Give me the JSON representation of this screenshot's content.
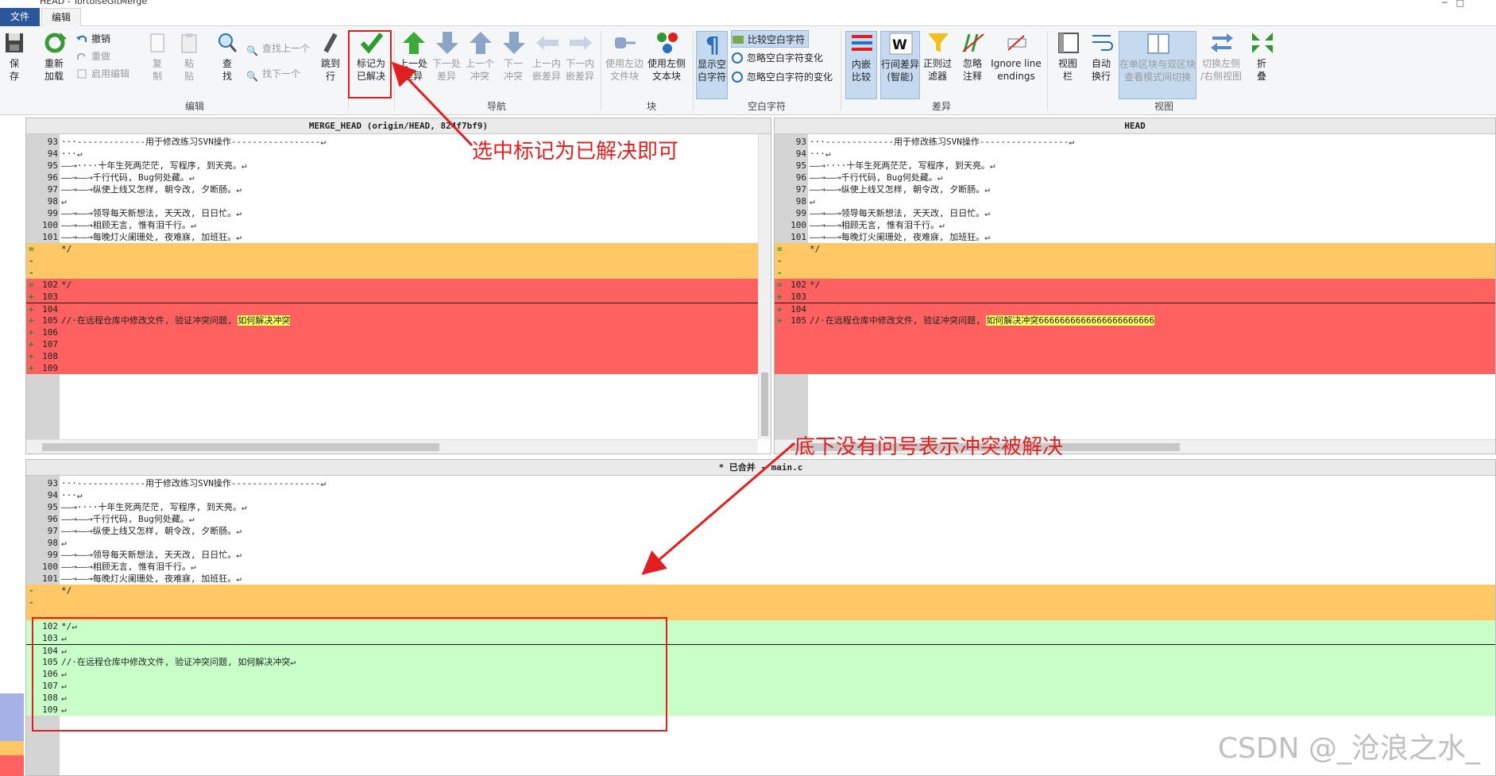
{
  "window": {
    "title": "HEAD - TortoiseGitMerge"
  },
  "tabs": {
    "file": "文件",
    "edit": "编辑"
  },
  "ribbon": {
    "save": "保\n存",
    "reload": "重新\n加载",
    "undo": "撤销",
    "redo": "重做",
    "enable_edit": "启用编辑",
    "copy": "复\n制",
    "paste": "粘\n贴",
    "find": "查\n找",
    "find_prev": "查找上一个",
    "find_next": "找下一个",
    "goto": "跳到\n行",
    "mark_resolved": "标记为\n已解决",
    "prev_diff": "上一处\n差异",
    "next_diff": "下一处\n差异",
    "prev_conflict": "上一个\n冲突",
    "next_conflict": "下一\n冲突",
    "prev_inline": "上一内\n嵌差异",
    "next_inline": "下一内\n嵌差异",
    "use_left_block": "使用左边\n文件块",
    "use_left_text": "使用左侧\n文本块",
    "show_ws": "显示空\n白字符",
    "compare_ws": "比较空白字符",
    "ignore_ws_change": "忽略空白字符变化",
    "ignore_ws_changes": "忽略空白字符的变化",
    "inline_compare": "内嵌\n比较",
    "line_diff_smart": "行间差异\n(智能)",
    "regex_filter": "正则过\n滤器",
    "ignore_comments": "忽略\n注释",
    "ignore_line_endings": "Ignore line\nendings",
    "view_bar": "视图\n栏",
    "auto_wrap": "自动\n换行",
    "toggle_view": "在单区块与双区块\n查看模式间切换",
    "swap_view": "切换左侧\n/右侧视图",
    "fold": "折\n叠",
    "groups": {
      "edit": "编辑",
      "nav": "导航",
      "block": "块",
      "whitespace": "空白字符",
      "diff": "差异",
      "view": "视图"
    }
  },
  "left_pane": {
    "header": "MERGE_HEAD (origin/HEAD, 824f7bf9)",
    "lines": [
      {
        "mk": "",
        "num": "93",
        "text": "···-------------用于修改练习SVN操作-----------------↵",
        "bg": ""
      },
      {
        "mk": "",
        "num": "94",
        "text": "···↵",
        "bg": ""
      },
      {
        "mk": "",
        "num": "95",
        "text": "——→····十年生死两茫茫, 写程序, 到天亮。↵",
        "bg": ""
      },
      {
        "mk": "",
        "num": "96",
        "text": "——→——→千行代码, Bug何处藏。↵",
        "bg": ""
      },
      {
        "mk": "",
        "num": "97",
        "text": "——→——→纵使上线又怎样, 朝令改, 夕断肠。↵",
        "bg": ""
      },
      {
        "mk": "",
        "num": "98",
        "text": "↵",
        "bg": ""
      },
      {
        "mk": "",
        "num": "99",
        "text": "——→——→领导每天新想法, 天天改, 日日忙。↵",
        "bg": ""
      },
      {
        "mk": "",
        "num": "100",
        "text": "——→——→相顾无言, 惟有泪千行。↵",
        "bg": ""
      },
      {
        "mk": "",
        "num": "101",
        "text": "——→——→每晚灯火阑珊处, 夜难寐, 加班狂。↵",
        "bg": ""
      },
      {
        "mk": "=",
        "num": "",
        "text": "*/",
        "bg": "orange"
      },
      {
        "mk": "-",
        "num": "",
        "text": "",
        "bg": "orange"
      },
      {
        "mk": "-",
        "num": "",
        "text": "",
        "bg": "orange"
      },
      {
        "mk": "=",
        "num": "102",
        "text": "*/",
        "bg": "red"
      },
      {
        "mk": "+",
        "num": "103",
        "text": "",
        "bg": "red"
      },
      {
        "mk": "+",
        "num": "104",
        "text": "",
        "bg": "red"
      },
      {
        "mk": "+",
        "num": "105",
        "text": "//·在远程仓库中修改文件, 验证冲突问题, ",
        "hl": "如何解决冲突",
        "bg": "red"
      },
      {
        "mk": "+",
        "num": "106",
        "text": "",
        "bg": "red"
      },
      {
        "mk": "+",
        "num": "107",
        "text": "",
        "bg": "red"
      },
      {
        "mk": "+",
        "num": "108",
        "text": "",
        "bg": "red"
      },
      {
        "mk": "+",
        "num": "109",
        "text": "",
        "bg": "red"
      }
    ]
  },
  "right_pane": {
    "header": "HEAD",
    "lines": [
      {
        "mk": "",
        "num": "93",
        "text": "···-------------用于修改练习SVN操作-----------------↵",
        "bg": ""
      },
      {
        "mk": "",
        "num": "94",
        "text": "···↵",
        "bg": ""
      },
      {
        "mk": "",
        "num": "95",
        "text": "——→····十年生死两茫茫, 写程序, 到天亮。↵",
        "bg": ""
      },
      {
        "mk": "",
        "num": "96",
        "text": "——→——→千行代码, Bug何处藏。↵",
        "bg": ""
      },
      {
        "mk": "",
        "num": "97",
        "text": "——→——→纵使上线又怎样, 朝令改, 夕断肠。↵",
        "bg": ""
      },
      {
        "mk": "",
        "num": "98",
        "text": "↵",
        "bg": ""
      },
      {
        "mk": "",
        "num": "99",
        "text": "——→——→领导每天新想法, 天天改, 日日忙。↵",
        "bg": ""
      },
      {
        "mk": "",
        "num": "100",
        "text": "——→——→相顾无言, 惟有泪千行。↵",
        "bg": ""
      },
      {
        "mk": "",
        "num": "101",
        "text": "——→——→每晚灯火阑珊处, 夜难寐, 加班狂。↵",
        "bg": ""
      },
      {
        "mk": "=",
        "num": "",
        "text": "*/",
        "bg": "orange"
      },
      {
        "mk": "-",
        "num": "",
        "text": "",
        "bg": "orange"
      },
      {
        "mk": "-",
        "num": "",
        "text": "",
        "bg": "orange"
      },
      {
        "mk": "=",
        "num": "102",
        "text": "*/",
        "bg": "red"
      },
      {
        "mk": "+",
        "num": "103",
        "text": "",
        "bg": "red"
      },
      {
        "mk": "+",
        "num": "104",
        "text": "",
        "bg": "red"
      },
      {
        "mk": "+",
        "num": "105",
        "text": "//·在远程仓库中修改文件, 验证冲突问题, ",
        "hl": "如何解决冲突6666666666666666666666",
        "bg": "red"
      },
      {
        "mk": "",
        "num": "",
        "text": "",
        "bg": "red"
      },
      {
        "mk": "",
        "num": "",
        "text": "",
        "bg": "red"
      },
      {
        "mk": "",
        "num": "",
        "text": "",
        "bg": "red"
      },
      {
        "mk": "",
        "num": "",
        "text": "",
        "bg": "red"
      }
    ]
  },
  "bottom_pane": {
    "header": "* 已合并 - main.c",
    "lines": [
      {
        "mk": "",
        "num": "93",
        "text": "···-------------用于修改练习SVN操作-----------------↵",
        "bg": ""
      },
      {
        "mk": "",
        "num": "94",
        "text": "···↵",
        "bg": ""
      },
      {
        "mk": "",
        "num": "95",
        "text": "——→····十年生死两茫茫, 写程序, 到天亮。↵",
        "bg": ""
      },
      {
        "mk": "",
        "num": "96",
        "text": "——→——→千行代码, Bug何处藏。↵",
        "bg": ""
      },
      {
        "mk": "",
        "num": "97",
        "text": "——→——→纵使上线又怎样, 朝令改, 夕断肠。↵",
        "bg": ""
      },
      {
        "mk": "",
        "num": "98",
        "text": "↵",
        "bg": ""
      },
      {
        "mk": "",
        "num": "99",
        "text": "——→——→领导每天新想法, 天天改, 日日忙。↵",
        "bg": ""
      },
      {
        "mk": "",
        "num": "100",
        "text": "——→——→相顾无言, 惟有泪千行。↵",
        "bg": ""
      },
      {
        "mk": "",
        "num": "101",
        "text": "——→——→每晚灯火阑珊处, 夜难寐, 加班狂。↵",
        "bg": ""
      },
      {
        "mk": "-",
        "num": "",
        "text": "*/",
        "bg": "orange"
      },
      {
        "mk": "-",
        "num": "",
        "text": "",
        "bg": "orange"
      },
      {
        "mk": "",
        "num": "",
        "text": "",
        "bg": "orange"
      },
      {
        "mk": "",
        "num": "102",
        "text": "*/↵",
        "bg": "green"
      },
      {
        "mk": "",
        "num": "103",
        "text": "↵",
        "bg": "green"
      },
      {
        "mk": "",
        "num": "104",
        "text": "↵",
        "bg": "green"
      },
      {
        "mk": "",
        "num": "105",
        "text": "//·在远程仓库中修改文件, 验证冲突问题, 如何解决冲突↵",
        "bg": "green"
      },
      {
        "mk": "",
        "num": "106",
        "text": "↵",
        "bg": "green"
      },
      {
        "mk": "",
        "num": "107",
        "text": "↵",
        "bg": "green"
      },
      {
        "mk": "",
        "num": "108",
        "text": "↵",
        "bg": "green"
      },
      {
        "mk": "",
        "num": "109",
        "text": "↵",
        "bg": "green"
      }
    ]
  },
  "annotations": {
    "mark_resolved_note": "选中标记为已解决即可",
    "no_question_note": "底下没有问号表示冲突被解决"
  },
  "watermark": "CSDN @_沧浪之水_",
  "colors": {
    "annot": "#e02020",
    "orange": "#ffc766",
    "red": "#ff6060",
    "green": "#c8ffc8"
  }
}
